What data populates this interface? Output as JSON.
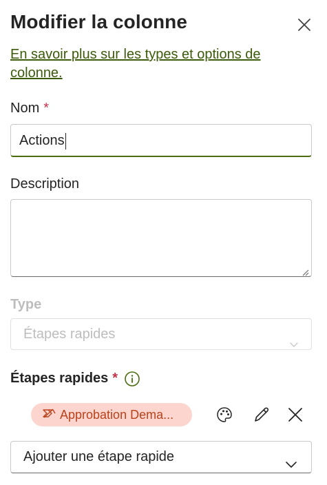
{
  "panel": {
    "title": "Modifier la colonne",
    "learn_link": "En savoir plus sur les types et options de colonne."
  },
  "name_field": {
    "label": "Nom",
    "required_mark": "*",
    "value": "Actions"
  },
  "description_field": {
    "label": "Description",
    "value": ""
  },
  "type_field": {
    "label": "Type",
    "selected": "Étapes rapides",
    "disabled": true
  },
  "quick_steps": {
    "label": "Étapes rapides",
    "required_mark": "*",
    "items": [
      {
        "label": "Approbation Dema...",
        "icon": "quick-step-icon"
      }
    ],
    "add_placeholder": "Ajouter une étape rapide"
  },
  "colors": {
    "accent": "#4a6a0c",
    "link": "#3b5a0a",
    "required": "#c4314b",
    "pill_bg": "#fdd5cf",
    "pill_text": "#b8421b"
  }
}
